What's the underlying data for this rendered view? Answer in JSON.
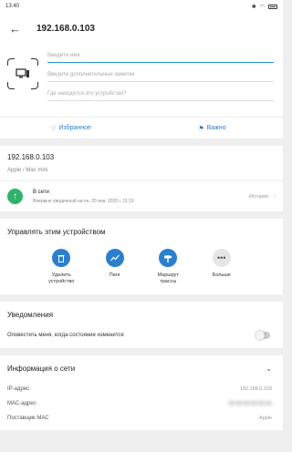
{
  "status_bar": {
    "time": "13:40",
    "battery_icon": "battery-icon"
  },
  "header": {
    "title": "192.168.0.103"
  },
  "edit": {
    "name_placeholder": "Введите имя",
    "notes_placeholder": "Введите дополнительные заметки",
    "location_placeholder": "Где находится это устройство?"
  },
  "favorites": {
    "favorite_label": "Избранное",
    "important_label": "Важно"
  },
  "device": {
    "ip": "192.168.0.103",
    "vendor": "Apple / Mac mini",
    "online_title": "В сети",
    "online_since": "Впервые увиденный на пн, 20 янв. 2020 г. 11:19",
    "history_label": "История"
  },
  "manage": {
    "title": "Управлять этим устройством",
    "actions": [
      {
        "label": "Удалить устройство"
      },
      {
        "label": "Пинг"
      },
      {
        "label": "Маршрут трассы"
      },
      {
        "label": "Больше"
      }
    ]
  },
  "notifications": {
    "title": "Уведомления",
    "notify_label": "Оповестить меня, когда состояние изменится"
  },
  "network": {
    "title": "Информация о сети",
    "rows": [
      {
        "label": "IP-адрес",
        "value": "192.168.0.103"
      },
      {
        "label": "МАС-адрес",
        "value": ""
      },
      {
        "label": "Поставщик МАС",
        "value": "Apple"
      }
    ]
  },
  "colors": {
    "accent": "#2a7fcf",
    "online": "#2fb26a",
    "field_active": "#2a8fd6"
  }
}
